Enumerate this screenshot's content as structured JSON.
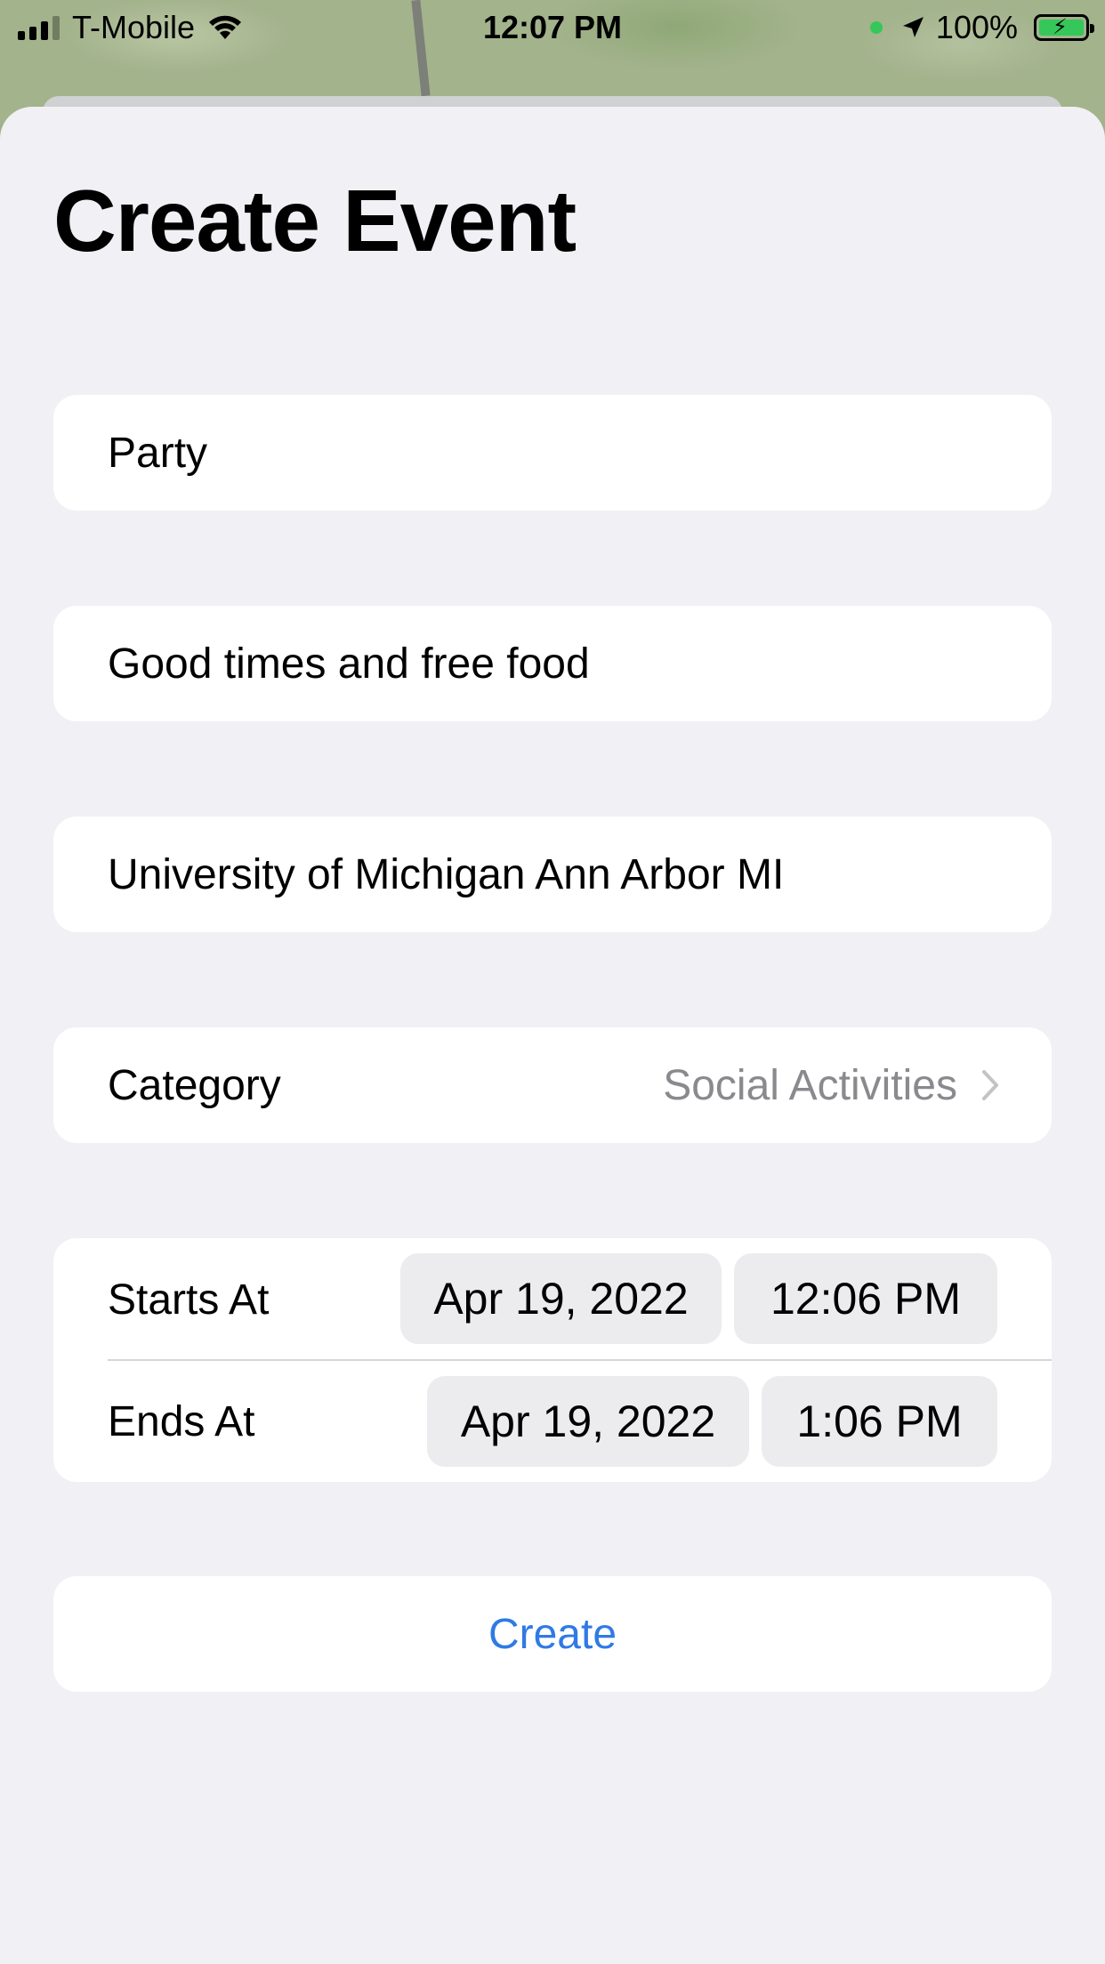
{
  "status_bar": {
    "carrier": "T-Mobile",
    "time": "12:07 PM",
    "battery": "100%",
    "signal_bars": 4
  },
  "title": "Create Event",
  "form": {
    "name_value": "Party",
    "description_value": "Good times and free food",
    "location_value": "University of Michigan Ann Arbor MI",
    "category": {
      "label": "Category",
      "value": "Social Activities"
    },
    "starts": {
      "label": "Starts At",
      "date": "Apr 19, 2022",
      "time": "12:06 PM"
    },
    "ends": {
      "label": "Ends At",
      "date": "Apr 19, 2022",
      "time": "1:06 PM"
    }
  },
  "create_label": "Create",
  "colors": {
    "accent": "#2f7ae5",
    "background": "#f0f0f5",
    "card": "#ffffff",
    "secondary_text": "#8a8a8e",
    "pill": "#ececee"
  }
}
